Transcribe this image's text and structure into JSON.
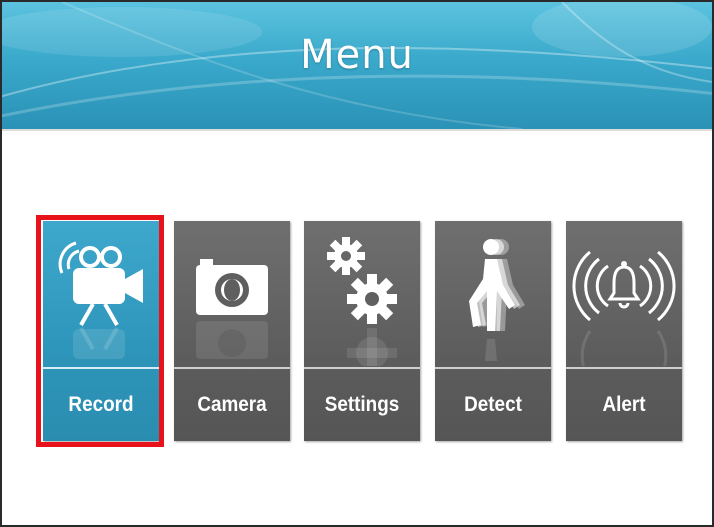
{
  "header": {
    "title": "Menu"
  },
  "menu": {
    "items": [
      {
        "label": "Record",
        "icon": "video-camera-icon",
        "selected": true
      },
      {
        "label": "Camera",
        "icon": "camera-icon",
        "selected": false
      },
      {
        "label": "Settings",
        "icon": "gears-icon",
        "selected": false
      },
      {
        "label": "Detect",
        "icon": "walking-person-icon",
        "selected": false
      },
      {
        "label": "Alert",
        "icon": "bell-alarm-icon",
        "selected": false
      }
    ]
  },
  "colors": {
    "header": "#3aa9cb",
    "tile": "#616161",
    "tile_active": "#2d95b9",
    "selection": "#e8121a"
  }
}
